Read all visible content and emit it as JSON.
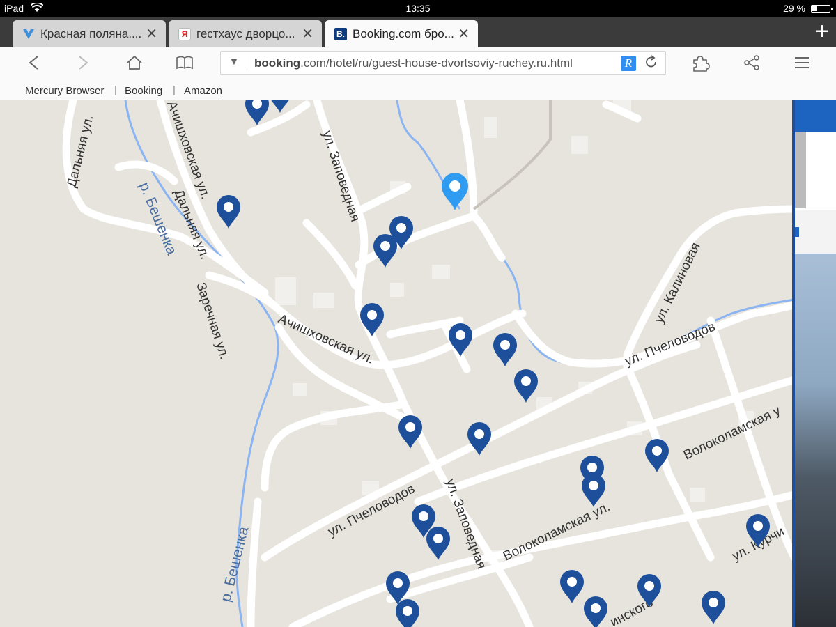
{
  "status_bar": {
    "device": "iPad",
    "time": "13:35",
    "battery_pct": 29,
    "battery_text": "29 %"
  },
  "tabs": [
    {
      "title": "Красная поляна....",
      "favicon": "yandex-mark-icon",
      "active": false
    },
    {
      "title": "гестхаус дворцо...",
      "favicon": "yandex-y-icon",
      "active": false
    },
    {
      "title": "Booking.com бро...",
      "favicon": "booking-b-icon",
      "active": true
    }
  ],
  "toolbar": {
    "url_domain": "booking",
    "url_rest": ".com/hotel/ru/guest-house-dvortsoviy-ruchey.ru.html",
    "extension_letter": "R"
  },
  "bookmarks": [
    "Mercury Browser",
    "Booking",
    "Amazon"
  ],
  "map": {
    "street_labels": {
      "dalnyaya_top": "Дальняя ул.",
      "achishkhovskaya_top": "Ачишховская ул.",
      "zapovednaya_top": "ул. Заповедная",
      "dalnyaya_mid": "Дальняя ул.",
      "beshenka_top": "р. Бешенка",
      "zarechnaya": "Заречная ул.",
      "achishkhovskaya_mid": "Ачишховская ул.",
      "kalinovaya": "ул. Калиновая",
      "pchelovodov_right": "ул. Пчеловодов",
      "volokolamskaya_right": "Волоколамская у",
      "pchelovodov_left": "ул. Пчеловодов",
      "zapovednaya_bottom": "ул. Заповедная",
      "volokolamskaya_mid": "Волоколамская ул.",
      "beshenka_bottom": "р. Бешенка",
      "kurchi": "ул. Курчи",
      "linskogo": "инского"
    },
    "selected_pin": "hotel-location",
    "pin_count": 23,
    "colors": {
      "land": "#e7e4dd",
      "road": "#ffffff",
      "river": "#8bb4f2",
      "pin": "#1e4f9a",
      "selected_pin": "#2f9cf2"
    }
  }
}
